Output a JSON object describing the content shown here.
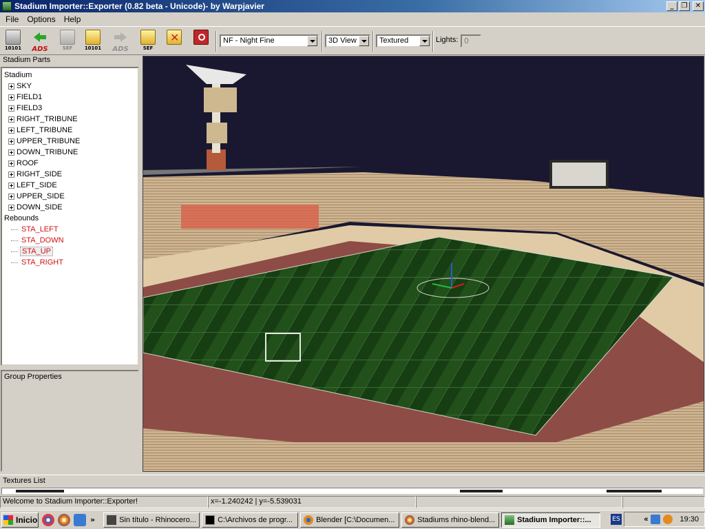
{
  "window": {
    "title": "Stadium Importer::Exporter (0.82 beta - Unicode)- by Warpjavier",
    "minimize": "_",
    "maximize": "❐",
    "close": "✕"
  },
  "menu": [
    "File",
    "Options",
    "Help"
  ],
  "toolbar": {
    "buttons": [
      {
        "icon": "disk-icon",
        "caption": "10101"
      },
      {
        "icon": "import-arrow-icon",
        "caption": "ADS"
      },
      {
        "icon": "disk-grey-icon",
        "caption": "SEF"
      },
      {
        "icon": "folder-icon",
        "caption": "10101"
      },
      {
        "icon": "export-arrow-icon",
        "caption": "ADS"
      },
      {
        "icon": "folder-icon",
        "caption": "SEF"
      },
      {
        "icon": "folder-delete-icon",
        "caption": ""
      },
      {
        "icon": "power-icon",
        "caption": ""
      }
    ],
    "lighting_select": "NF - Night Fine",
    "view_select": "3D View",
    "render_select": "Textured",
    "lights_label": "Lights:",
    "lights_value": "0"
  },
  "stadium_parts": {
    "header": "Stadium Parts",
    "root": "Stadium",
    "groups": [
      "SKY",
      "FIELD1",
      "FIELD3",
      "RIGHT_TRIBUNE",
      "LEFT_TRIBUNE",
      "UPPER_TRIBUNE",
      "DOWN_TRIBUNE",
      "ROOF",
      "RIGHT_SIDE",
      "LEFT_SIDE",
      "UPPER_SIDE",
      "DOWN_SIDE"
    ],
    "rebounds_label": "Rebounds",
    "rebounds": [
      "STA_LEFT",
      "STA_DOWN",
      "STA_UP",
      "STA_RIGHT"
    ],
    "selected": "STA_UP"
  },
  "group_properties": {
    "header": "Group Properties"
  },
  "textures": {
    "header": "Textures List"
  },
  "status": {
    "message": "Welcome to Stadium Importer::Exporter!",
    "coords": "x=-1.240242 | y=-5.539031",
    "empty1": "",
    "empty2": ""
  },
  "taskbar": {
    "start": "Inicio",
    "tasks": [
      {
        "label": "Sin título - Rhinocero...",
        "active": false
      },
      {
        "label": "C:\\Archivos de progr...",
        "active": false
      },
      {
        "label": "Blender [C:\\Documen...",
        "active": false
      },
      {
        "label": "Stadiums rhino-blend...",
        "active": false
      },
      {
        "label": "Stadium Importer::...",
        "active": true
      }
    ],
    "language": "ES",
    "clock": "19:30",
    "chevron": "»",
    "tray_chevron": "«"
  },
  "colors": {
    "title_start": "#0a246a",
    "leaf_red": "#d01010",
    "sky": "#1a1830",
    "pitch": "#1f4a17",
    "track": "#8e4c46",
    "stands": "#c9b08a"
  }
}
